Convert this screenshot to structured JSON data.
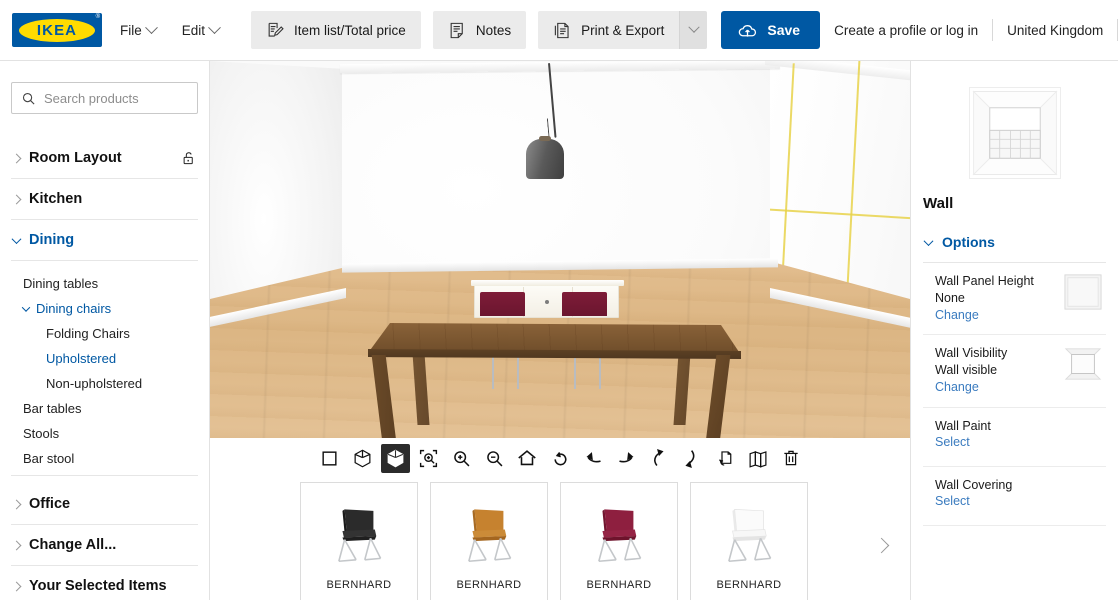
{
  "app": {
    "brand": "IKEA",
    "brand_registered": "®",
    "brand_color": "#0058A3",
    "accent_yellow": "#FFDB00"
  },
  "topbar": {
    "menus": [
      {
        "label": "File",
        "icon": "chevron-down-icon"
      },
      {
        "label": "Edit",
        "icon": "chevron-down-icon"
      }
    ],
    "buttons": [
      {
        "label": "Item list/Total price",
        "icon": "item-list-icon"
      },
      {
        "label": "Notes",
        "icon": "notes-icon"
      },
      {
        "label": "Print & Export",
        "icon": "print-export-icon",
        "has_dropdown": true
      }
    ],
    "save": {
      "label": "Save",
      "icon": "cloud-upload-icon"
    },
    "account_link": "Create a profile or log in",
    "country": "United Kingdom",
    "help": "?"
  },
  "sidebar": {
    "search": {
      "placeholder": "Search products",
      "value": "",
      "icon": "search-icon"
    },
    "groups": [
      {
        "label": "Room Layout",
        "expanded": false,
        "lock_icon": "unlocked-icon"
      },
      {
        "label": "Kitchen",
        "expanded": false
      },
      {
        "label": "Dining",
        "expanded": true,
        "active": true
      }
    ],
    "dining_items": [
      {
        "label": "Dining tables",
        "level": 1,
        "expandable": false,
        "selected": false
      },
      {
        "label": "Dining chairs",
        "level": 1,
        "expandable": true,
        "expanded": true,
        "selected": false,
        "highlighted": true
      },
      {
        "label": "Folding Chairs",
        "level": 2,
        "selected": false
      },
      {
        "label": "Upholstered",
        "level": 2,
        "selected": true
      },
      {
        "label": "Non-upholstered",
        "level": 2,
        "selected": false
      },
      {
        "label": "Bar tables",
        "level": 1,
        "expandable": false,
        "selected": false
      },
      {
        "label": "Stools",
        "level": 1,
        "expandable": false,
        "selected": false
      },
      {
        "label": "Bar stool",
        "level": 1,
        "expandable": false,
        "selected": false
      }
    ],
    "groups_bottom": [
      {
        "label": "Office",
        "expanded": false
      },
      {
        "label": "Change All...",
        "expanded": false
      },
      {
        "label": "Your Selected Items",
        "expanded": false
      }
    ]
  },
  "viewtools": [
    {
      "name": "view-2d-icon",
      "selected": false
    },
    {
      "name": "view-3d-wire-icon",
      "selected": false
    },
    {
      "name": "view-3d-solid-icon",
      "selected": true
    },
    {
      "name": "zoom-to-fit-icon",
      "selected": false
    },
    {
      "name": "zoom-in-icon",
      "selected": false
    },
    {
      "name": "zoom-out-icon",
      "selected": false
    },
    {
      "name": "home-view-icon",
      "selected": false
    },
    {
      "name": "rotate-ccw-icon",
      "selected": false
    },
    {
      "name": "pan-left-icon",
      "selected": false
    },
    {
      "name": "pan-right-icon",
      "selected": false
    },
    {
      "name": "tilt-up-icon",
      "selected": false
    },
    {
      "name": "tilt-down-icon",
      "selected": false
    },
    {
      "name": "rotate-object-icon",
      "selected": false
    },
    {
      "name": "unfold-walls-icon",
      "selected": false
    },
    {
      "name": "delete-icon",
      "selected": false
    }
  ],
  "carousel": {
    "products": [
      {
        "name": "BERNHARD",
        "color": "#2b2b2b",
        "color_name": "black"
      },
      {
        "name": "BERNHARD",
        "color": "#c6822f",
        "color_name": "golden-brown"
      },
      {
        "name": "BERNHARD",
        "color": "#8e1f3f",
        "color_name": "dark-red"
      },
      {
        "name": "BERNHARD",
        "color": "#f2f2f2",
        "color_name": "white"
      }
    ],
    "next_icon": "chevron-right-icon"
  },
  "rightpanel": {
    "thumbnail_icon": "wall-preview-icon",
    "title": "Wall",
    "options_label": "Options",
    "options_chevron": "chevron-down-icon",
    "options": [
      {
        "label": "Wall Panel Height",
        "value": "None",
        "action": "Change",
        "thumb": "panel-swatch-icon"
      },
      {
        "label": "Wall Visibility",
        "value": "Wall visible",
        "action": "Change",
        "thumb": "wall-visible-icon"
      },
      {
        "label": "Wall Paint",
        "value": "",
        "action": "Select",
        "thumb": ""
      },
      {
        "label": "Wall Covering",
        "value": "",
        "action": "Select",
        "thumb": ""
      }
    ]
  },
  "scene": {
    "description": "3D dining room: white walls, light wood floor, dark wood dining table, two dark red upholstered chairs, white sideboard, grey pendant lamp",
    "selected_wall_grid_color": "#e8d24a",
    "floor_color": "#dcb684",
    "table_color": "#7a5630",
    "chair_color": "#7e1c38"
  }
}
